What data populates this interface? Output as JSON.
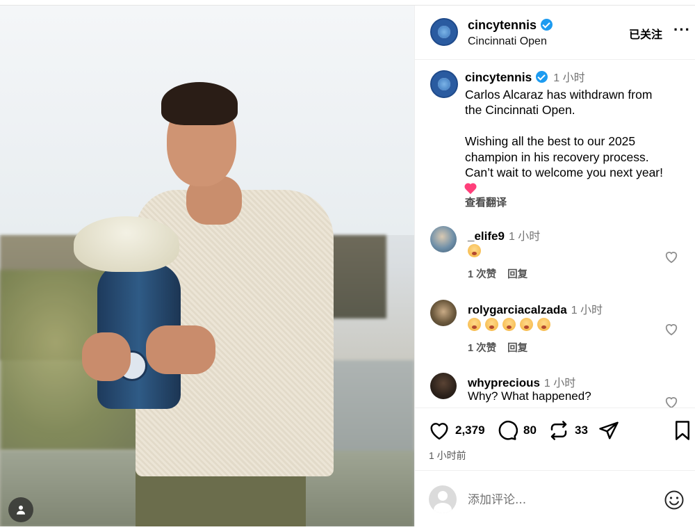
{
  "post": {
    "username": "cincytennis",
    "subtitle": "Cincinnati Open",
    "follow_label": "已关注",
    "more_label": "···",
    "caption_time": "1 小时",
    "caption_line1": "Carlos Alcaraz has withdrawn from",
    "caption_line2": "the Cincinnati Open.",
    "caption_line3": "Wishing all the best to our 2025",
    "caption_line4": "champion in his recovery process.",
    "caption_line5": "Can’t wait to welcome you next year!",
    "translate_label": "查看翻译"
  },
  "comments": [
    {
      "user": "_elife9",
      "time": "1 小时",
      "likes_label": "1 次赞",
      "reply_label": "回复"
    },
    {
      "user": "rolygarciacalzada",
      "time": "1 小时",
      "likes_label": "1 次赞",
      "reply_label": "回复"
    },
    {
      "user": "whyprecious",
      "time": "1 小时",
      "text": "Why? What happened?"
    }
  ],
  "actions": {
    "likes": "2,379",
    "comments": "80",
    "reposts": "33"
  },
  "posted_time": "1 小时前",
  "composer": {
    "placeholder": "添加评论..."
  },
  "colors": {
    "verified": "#1d9bf0",
    "brand_blue": "#2a5ba0",
    "heart_emoji": "#ff3f7a"
  }
}
